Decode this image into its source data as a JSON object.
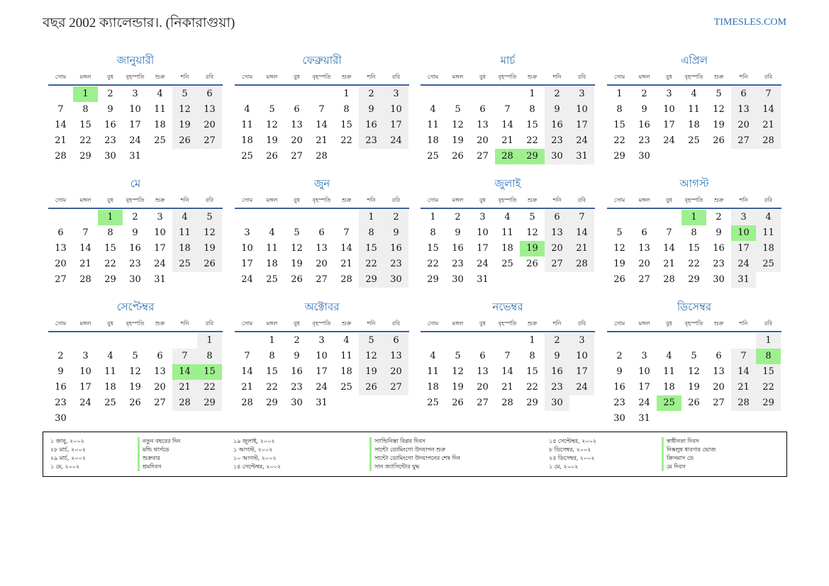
{
  "title": "বছর 2002 ক্যালেন্ডার।. (নিকারাগুয়া)",
  "site": "TIMESLES.COM",
  "colors": {
    "accent": "#2a6fb5",
    "holiday": "#9ef08e",
    "weekend": "#efefef",
    "rule": "#3d5f9a"
  },
  "weekdays": [
    "সোম",
    "মঙ্গল",
    "বুধ",
    "বৃহস্পতি",
    "শুক্র",
    "শনি",
    "রবি"
  ],
  "months": [
    {
      "name": "জানুয়ারী",
      "offset": 1,
      "days": 31,
      "holidays": [
        1
      ]
    },
    {
      "name": "ফেব্রুয়ারী",
      "offset": 4,
      "days": 28,
      "holidays": []
    },
    {
      "name": "মার্চ",
      "offset": 4,
      "days": 31,
      "holidays": [
        28,
        29
      ]
    },
    {
      "name": "এপ্রিল",
      "offset": 0,
      "days": 30,
      "holidays": []
    },
    {
      "name": "মে",
      "offset": 2,
      "days": 31,
      "holidays": [
        1
      ]
    },
    {
      "name": "জুন",
      "offset": 5,
      "days": 30,
      "holidays": []
    },
    {
      "name": "জুলাই",
      "offset": 0,
      "days": 31,
      "holidays": [
        19
      ]
    },
    {
      "name": "আগস্ট",
      "offset": 3,
      "days": 31,
      "holidays": [
        1,
        10
      ]
    },
    {
      "name": "সেপ্টেম্বর",
      "offset": 6,
      "days": 30,
      "holidays": [
        14,
        15
      ]
    },
    {
      "name": "অক্টোবর",
      "offset": 1,
      "days": 31,
      "holidays": []
    },
    {
      "name": "নভেম্বর",
      "offset": 4,
      "days": 30,
      "holidays": []
    },
    {
      "name": "ডিসেম্বর",
      "offset": 6,
      "days": 31,
      "holidays": [
        8,
        25
      ]
    }
  ],
  "holidays": [
    {
      "date": "১ জানু, ২০০২",
      "name": "নতুন বছরের দিন"
    },
    {
      "date": "২৮ মার্চ, ২০০২",
      "name": "মন্ডি থার্সডে"
    },
    {
      "date": "২৯ মার্চ, ২০০২",
      "name": "শুক্রবার"
    },
    {
      "date": "১ মে, ২০০২",
      "name": "শ্রমদিবস"
    },
    {
      "date": "১৯ জুলাই, ২০০২",
      "name": "স্যান্ডিনিস্তা বিপ্লব দিবস"
    },
    {
      "date": "১ আগস্ট, ২০০২",
      "name": "সান্টো ডোমিংগো উদযাপন শুরু"
    },
    {
      "date": "১০ আগস্ট, ২০০২",
      "name": "সান্টো ডোমিংগো উদযাপনের শেষ দিন"
    },
    {
      "date": "১৪ সেপ্টেম্বর, ২০০২",
      "name": "সান জ্যাসিন্টোর যুদ্ধ"
    },
    {
      "date": "১৫ সেপ্টেম্বর, ২০০২",
      "name": "স্বাধীনতা দিবস"
    },
    {
      "date": "৮ ডিসেম্বর, ২০০২",
      "name": "নিষ্কলুষ ধারণার ভোজ"
    },
    {
      "date": "২৫ ডিসেম্বর, ২০০২",
      "name": "ক্রিসমাস ডে"
    },
    {
      "date": "১ মে, ২০০২",
      "name": "মে দিবস"
    }
  ]
}
